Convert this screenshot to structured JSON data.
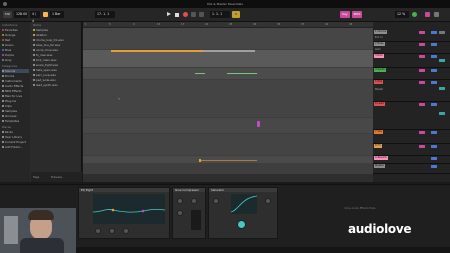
{
  "window": {
    "title": "Mix & Master Essentials"
  },
  "transport": {
    "tempo": "128.00",
    "time_sig": "4 / 4",
    "quantize": "1 Bar",
    "position": "17. 1. 1",
    "key": "Key",
    "midi": "MIDI",
    "cpu": "12 %"
  },
  "browser": {
    "categories_header": "Collections",
    "categories": [
      "Favorites",
      "Orange",
      "Red",
      "Green",
      "Blue",
      "Purple",
      "Gray",
      "Categories",
      "Sounds",
      "Drums",
      "Instruments",
      "Audio Effects",
      "MIDI Effects",
      "Max for Live",
      "Plug-Ins",
      "Clips",
      "Samples",
      "Grooves",
      "Templates",
      "Places",
      "Packs",
      "User Library",
      "Current Project"
    ],
    "category_colors": [
      "#c94a4a",
      "#e08a2e",
      "#d84a4a",
      "#58b35a",
      "#4a78d6",
      "#9a5ad6",
      "#888888"
    ],
    "files": [
      "Samples",
      "Ableton",
      "drums_loop_01.wav",
      "bass_line_02.wav",
      "vocal_chop.wav",
      "fx_riser.wav",
      "kick_main.wav",
      "snare_tight.wav",
      "hats_open.wav",
      "perc_loop.wav",
      "pad_wide.wav",
      "lead_synth.wav"
    ],
    "places": [
      "Packs",
      "User Library",
      "Current Project",
      "Add Folder..."
    ],
    "footer_left": "Tags",
    "footer_right": "Preview"
  },
  "arrangement": {
    "ruler_marks": [
      "1",
      "5",
      "9",
      "13",
      "17",
      "21",
      "25",
      "29",
      "33",
      "37",
      "41",
      "45"
    ],
    "lanes": 9
  },
  "mixer": {
    "tracks": [
      {
        "name": "1 Drums",
        "color": "#8e8e8e"
      },
      {
        "name": "2 Bass",
        "color": "#8e8e8e"
      },
      {
        "name": "3 Kick",
        "color": "#ff8fb8"
      },
      {
        "name": "4 Synth",
        "color": "#4caf50"
      },
      {
        "name": "5 Pad",
        "color": "#e05050"
      },
      {
        "name": "6 Lead",
        "color": "#e05050"
      },
      {
        "name": "7 Vox",
        "color": "#e07a2e"
      },
      {
        "name": "8 FX",
        "color": "#e0a050"
      },
      {
        "name": "A Reverb",
        "color": "#ff8fb8"
      },
      {
        "name": "Master",
        "color": "#888888"
      }
    ],
    "input_type": "Ext. In",
    "monitor_auto": "Auto",
    "output": "Master"
  },
  "devices": {
    "eq_title": "EQ Eight",
    "comp_title": "Glue Compressor",
    "sat_title": "Saturator",
    "drop_hint": "Drop Audio Effects Here"
  },
  "watermark": "audiolove"
}
